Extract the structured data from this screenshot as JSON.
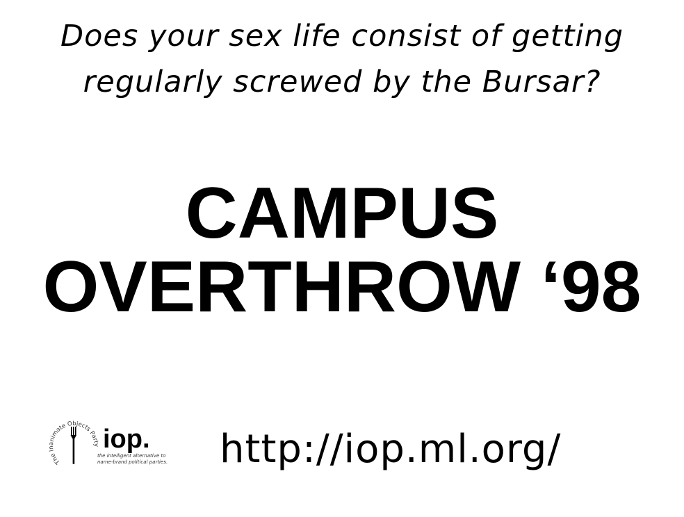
{
  "poster": {
    "tagline": {
      "line1": "Does your sex life consist of getting",
      "line2": "regularly screwed by the Bursar?"
    },
    "headline": {
      "line1": "CAMPUS",
      "line2": "OVERTHROW ‘98"
    },
    "logo": {
      "name": "iop.",
      "ring_text": "The Inanimate Objects Party",
      "slogan_line1": "the intelligent alternative to",
      "slogan_line2": "name-brand political parties."
    },
    "url": "http://iop.ml.org/"
  }
}
